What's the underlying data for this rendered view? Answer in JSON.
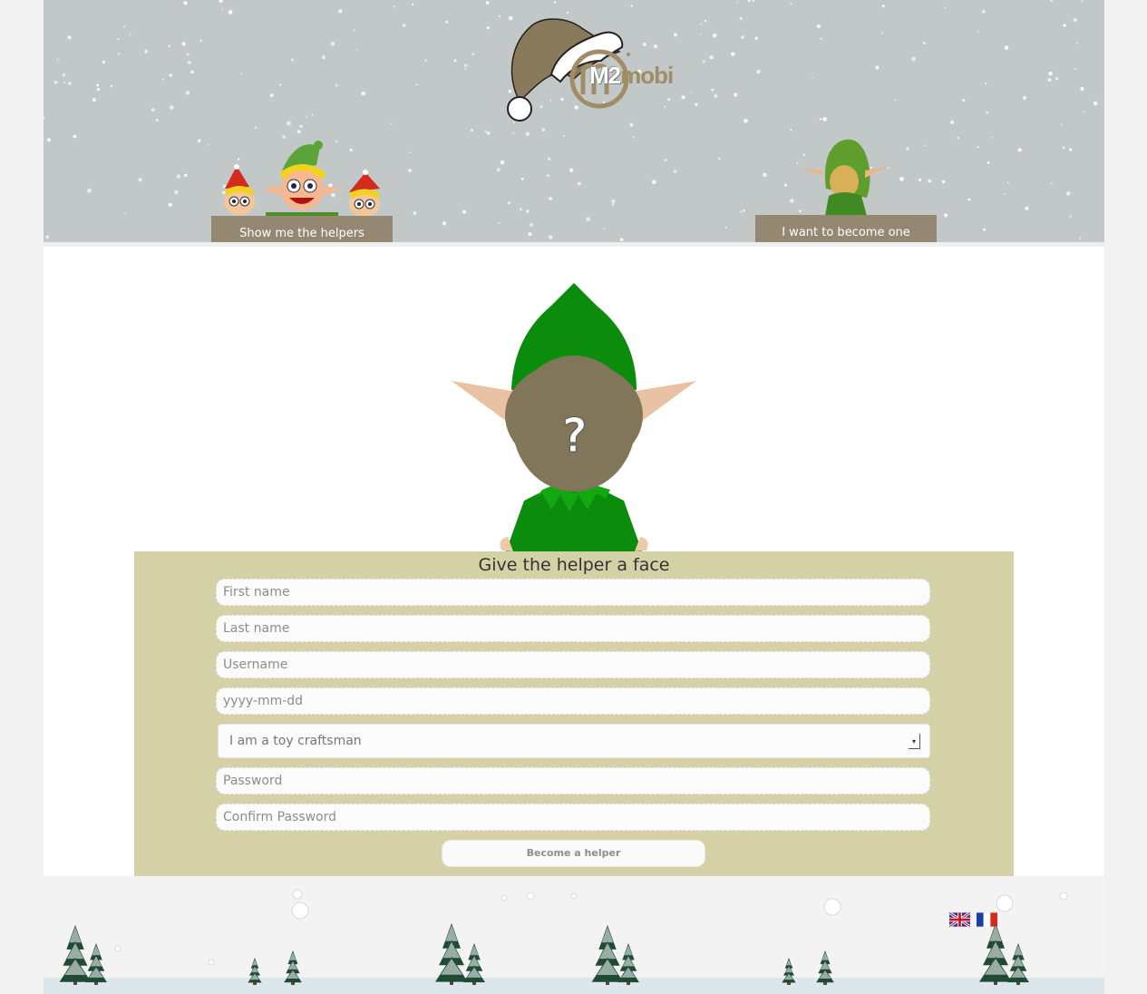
{
  "header": {
    "logo": {
      "text_m2": "M2",
      "text_mobi": "mobi",
      "icon": "santa-hat-m-logo-icon"
    },
    "nav": {
      "show_helpers_label": "Show me the helpers",
      "become_one_label": "I want to become one"
    }
  },
  "main": {
    "avatar": {
      "placeholder_glyph": "?",
      "icon": "faceless-elf-icon"
    },
    "form": {
      "title": "Give the helper a face",
      "first_name_placeholder": "First name",
      "last_name_placeholder": "Last name",
      "username_placeholder": "Username",
      "birthdate_placeholder": "yyyy-mm-dd",
      "role_selected": "I am a toy craftsman",
      "password_placeholder": "Password",
      "confirm_password_placeholder": "Confirm Password",
      "submit_label": "Become a helper"
    }
  },
  "footer": {
    "languages": [
      {
        "code": "en",
        "icon": "uk-flag-icon"
      },
      {
        "code": "fr",
        "icon": "france-flag-icon"
      }
    ]
  },
  "colors": {
    "header_bg": "#c2c8c8",
    "nav_button": "#958873",
    "form_panel": "#d4d1a7",
    "elf_green": "#0c8c0c",
    "elf_face": "#82765a",
    "logo_gold": "#a08c66"
  }
}
